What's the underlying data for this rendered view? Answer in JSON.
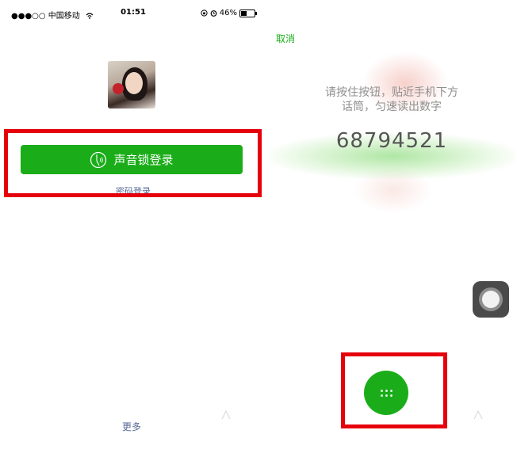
{
  "status_bar": {
    "carrier": "●●●○○ 中国移动",
    "time": "01:51",
    "battery": "46%",
    "battery_level": 0.46
  },
  "login": {
    "voice_login_label": "声音锁登录",
    "password_login_label": "密码登录",
    "more_label": "更多"
  },
  "voice_lock": {
    "cancel_label": "取消",
    "instruction_line1": "请按住按钮，贴近手机下方",
    "instruction_line2": "话筒，匀速读出数字",
    "digits": "68794521"
  },
  "colors": {
    "accent_green": "#1aad19",
    "link_blue": "#576b95",
    "highlight_red": "#e5000b"
  },
  "icons": [
    "wifi-icon",
    "lock-rotation-icon",
    "alarm-icon",
    "battery-icon",
    "voice-lock-icon",
    "mic-dots-icon",
    "assistive-touch-icon"
  ]
}
